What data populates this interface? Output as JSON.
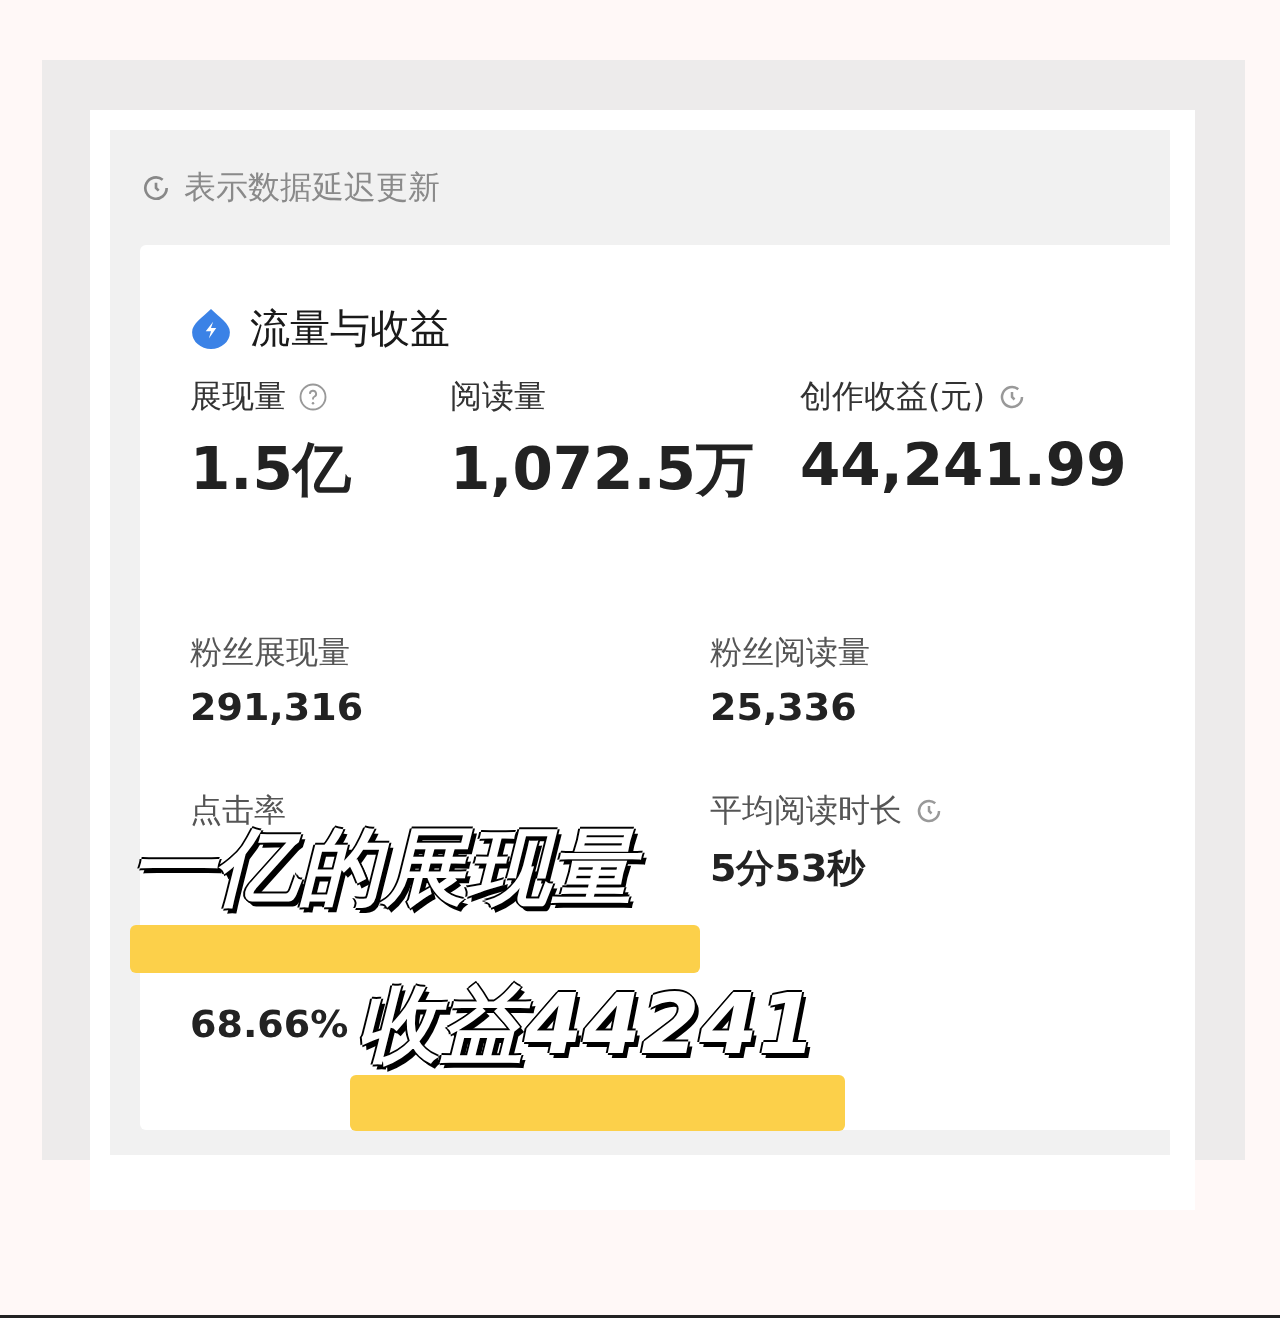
{
  "notice": {
    "text": "表示数据延迟更新"
  },
  "section": {
    "title": "流量与收益"
  },
  "primary_metrics": [
    {
      "label": "展现量",
      "help_icon": true,
      "value": "1.5亿"
    },
    {
      "label": "阅读量",
      "value": "1,072.5万"
    },
    {
      "label": "创作收益(元)",
      "clock_icon": true,
      "value": "44,241.99"
    }
  ],
  "secondary_metrics": [
    {
      "label": "粉丝展现量",
      "value": "291,316"
    },
    {
      "label": "粉丝阅读量",
      "value": "25,336"
    },
    {
      "label": "点击率"
    },
    {
      "label": "平均阅读时长",
      "clock_icon": true,
      "value": "5分53秒"
    },
    {
      "value": "68.66%"
    }
  ],
  "captions": [
    {
      "text": "一亿的展现量"
    },
    {
      "text": "收益44241"
    }
  ]
}
